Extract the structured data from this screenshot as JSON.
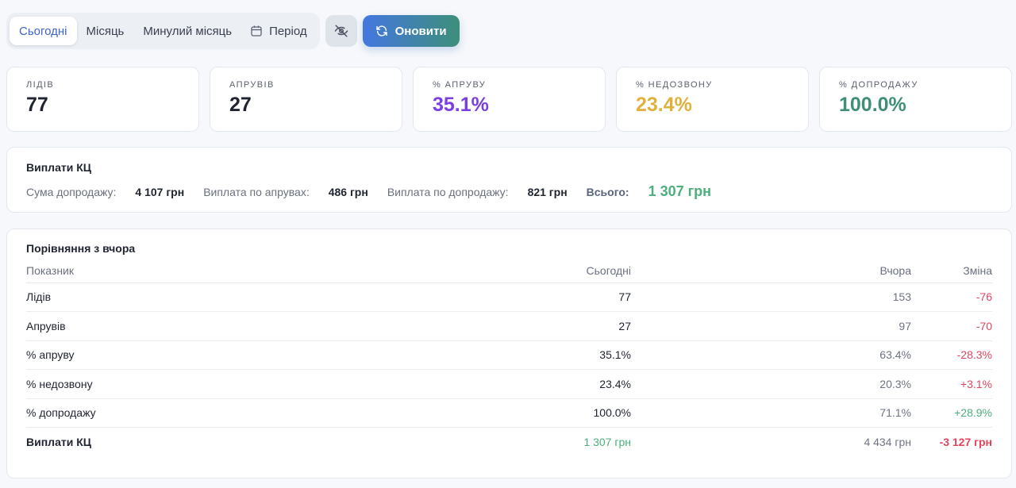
{
  "toolbar": {
    "tabs": [
      "Сьогодні",
      "Місяць",
      "Минулий місяць",
      "Період"
    ],
    "refresh_label": "Оновити"
  },
  "kpis": [
    {
      "label": "Лідів",
      "value": "77",
      "color": "#1f2430"
    },
    {
      "label": "Апрувів",
      "value": "27",
      "color": "#1f2430"
    },
    {
      "label": "% апруву",
      "value": "35.1%",
      "color": "#7b3fe0"
    },
    {
      "label": "% недозвону",
      "value": "23.4%",
      "color": "#e0b13c"
    },
    {
      "label": "% допродажу",
      "value": "100.0%",
      "color": "#3f8f78"
    }
  ],
  "payouts": {
    "title": "Виплати КЦ",
    "items": [
      {
        "label": "Сума допродажу:",
        "value": "4 107 грн"
      },
      {
        "label": "Виплата по апрувах:",
        "value": "486 грн"
      },
      {
        "label": "Виплата по допродажу:",
        "value": "821 грн"
      }
    ],
    "total_label": "Всього:",
    "total_value": "1 307 грн",
    "total_color": "#4caf7c"
  },
  "comparison": {
    "title": "Порівняння з вчора",
    "headers": [
      "Показник",
      "Сьогодні",
      "Вчора",
      "Зміна"
    ],
    "rows": [
      {
        "name": "Лідів",
        "today": "77",
        "yesterday": "153",
        "change": "-76",
        "change_color": "#e0455f"
      },
      {
        "name": "Апрувів",
        "today": "27",
        "yesterday": "97",
        "change": "-70",
        "change_color": "#e0455f"
      },
      {
        "name": "% апруву",
        "today": "35.1%",
        "yesterday": "63.4%",
        "change": "-28.3%",
        "change_color": "#e0455f"
      },
      {
        "name": "% недозвону",
        "today": "23.4%",
        "yesterday": "20.3%",
        "change": "+3.1%",
        "change_color": "#e0455f"
      },
      {
        "name": "% допродажу",
        "today": "100.0%",
        "yesterday": "71.1%",
        "change": "+28.9%",
        "change_color": "#4caf7c"
      },
      {
        "name": "Виплати КЦ",
        "today": "1 307 грн",
        "yesterday": "4 434 грн",
        "change": "-3 127 грн",
        "change_color": "#e0455f",
        "today_color": "#4caf7c"
      }
    ]
  }
}
